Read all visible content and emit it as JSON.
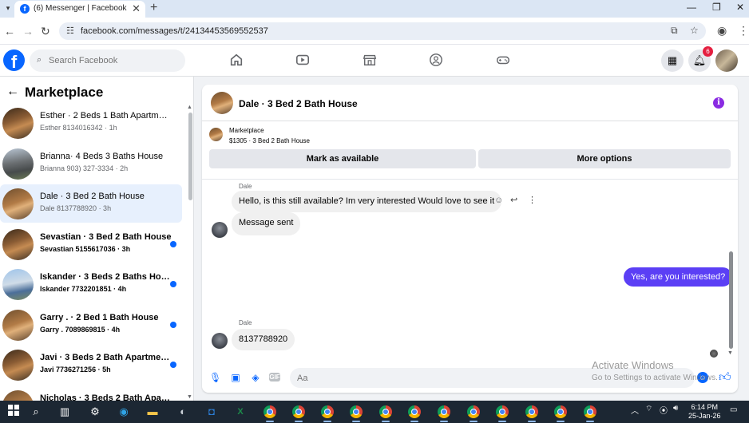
{
  "browser": {
    "tab_title": "(6) Messenger | Facebook",
    "tab_close": "✕",
    "new_tab": "+",
    "url": "facebook.com/messages/t/24134453569552537",
    "window_controls": [
      "—",
      "❐",
      "✕"
    ]
  },
  "fb_header": {
    "logo": "f",
    "search_placeholder": "Search Facebook",
    "notification_count": "6"
  },
  "sidebar": {
    "title": "Marketplace",
    "conversations": [
      {
        "name": "Esther · 2 Beds 1 Bath Apartmen...",
        "sub": "Esther 8134016342 · 1h",
        "unread": false,
        "active": false,
        "thumb": "house1"
      },
      {
        "name": "Brianna· 4 Beds 3 Baths House",
        "sub": "Brianna 903) 327-3334 · 2h",
        "unread": false,
        "active": false,
        "thumb": "house2"
      },
      {
        "name": "Dale · 3 Bed 2 Bath House",
        "sub": "Dale 8137788920 · 3h",
        "unread": false,
        "active": true,
        "thumb": "house4"
      },
      {
        "name": "Sevastian · 3 Bed 2 Bath House",
        "sub": "Sevastian 5155617036 · 3h",
        "unread": true,
        "active": false,
        "thumb": "house1"
      },
      {
        "name": "Iskander · 3 Beds 2 Baths House",
        "sub": "Iskander 7732201851 · 4h",
        "unread": true,
        "active": false,
        "thumb": "house3"
      },
      {
        "name": "Garry . · 2 Bed 1 Bath House",
        "sub": "Garry . 7089869815 · 4h",
        "unread": true,
        "active": false,
        "thumb": "house4"
      },
      {
        "name": "Javi · 3 Beds 2 Bath Apartment...",
        "sub": "Javi 7736271256 · 5h",
        "unread": true,
        "active": false,
        "thumb": "house1"
      },
      {
        "name": "Nicholas · 3 Beds 2 Bath Apart...",
        "sub": "",
        "unread": true,
        "active": false,
        "thumb": "house4"
      }
    ]
  },
  "chat": {
    "header_name": "Dale · 3 Bed 2 Bath House",
    "marketplace_label": "Marketplace",
    "listing": "$1305 · 3 Bed 2 Bath House",
    "mark_available": "Mark as available",
    "more_options": "More options",
    "messages": [
      {
        "sender": "Dale",
        "text": "Hello, is this still available? Im very interested  Would love to see it",
        "dir": "in"
      },
      {
        "sender": "",
        "text": "Message sent",
        "dir": "in"
      },
      {
        "sender": "",
        "text": "Yes, are you interested?",
        "dir": "out"
      },
      {
        "sender": "Dale",
        "text": "8137788920",
        "dir": "in"
      }
    ],
    "composer_placeholder": "Aa",
    "gif_label": "GIF"
  },
  "watermark": {
    "line1": "Activate Windows",
    "line2": "Go to Settings to activate Windows."
  },
  "taskbar": {
    "time": "6:14 PM",
    "date": "25-Jan-26"
  }
}
